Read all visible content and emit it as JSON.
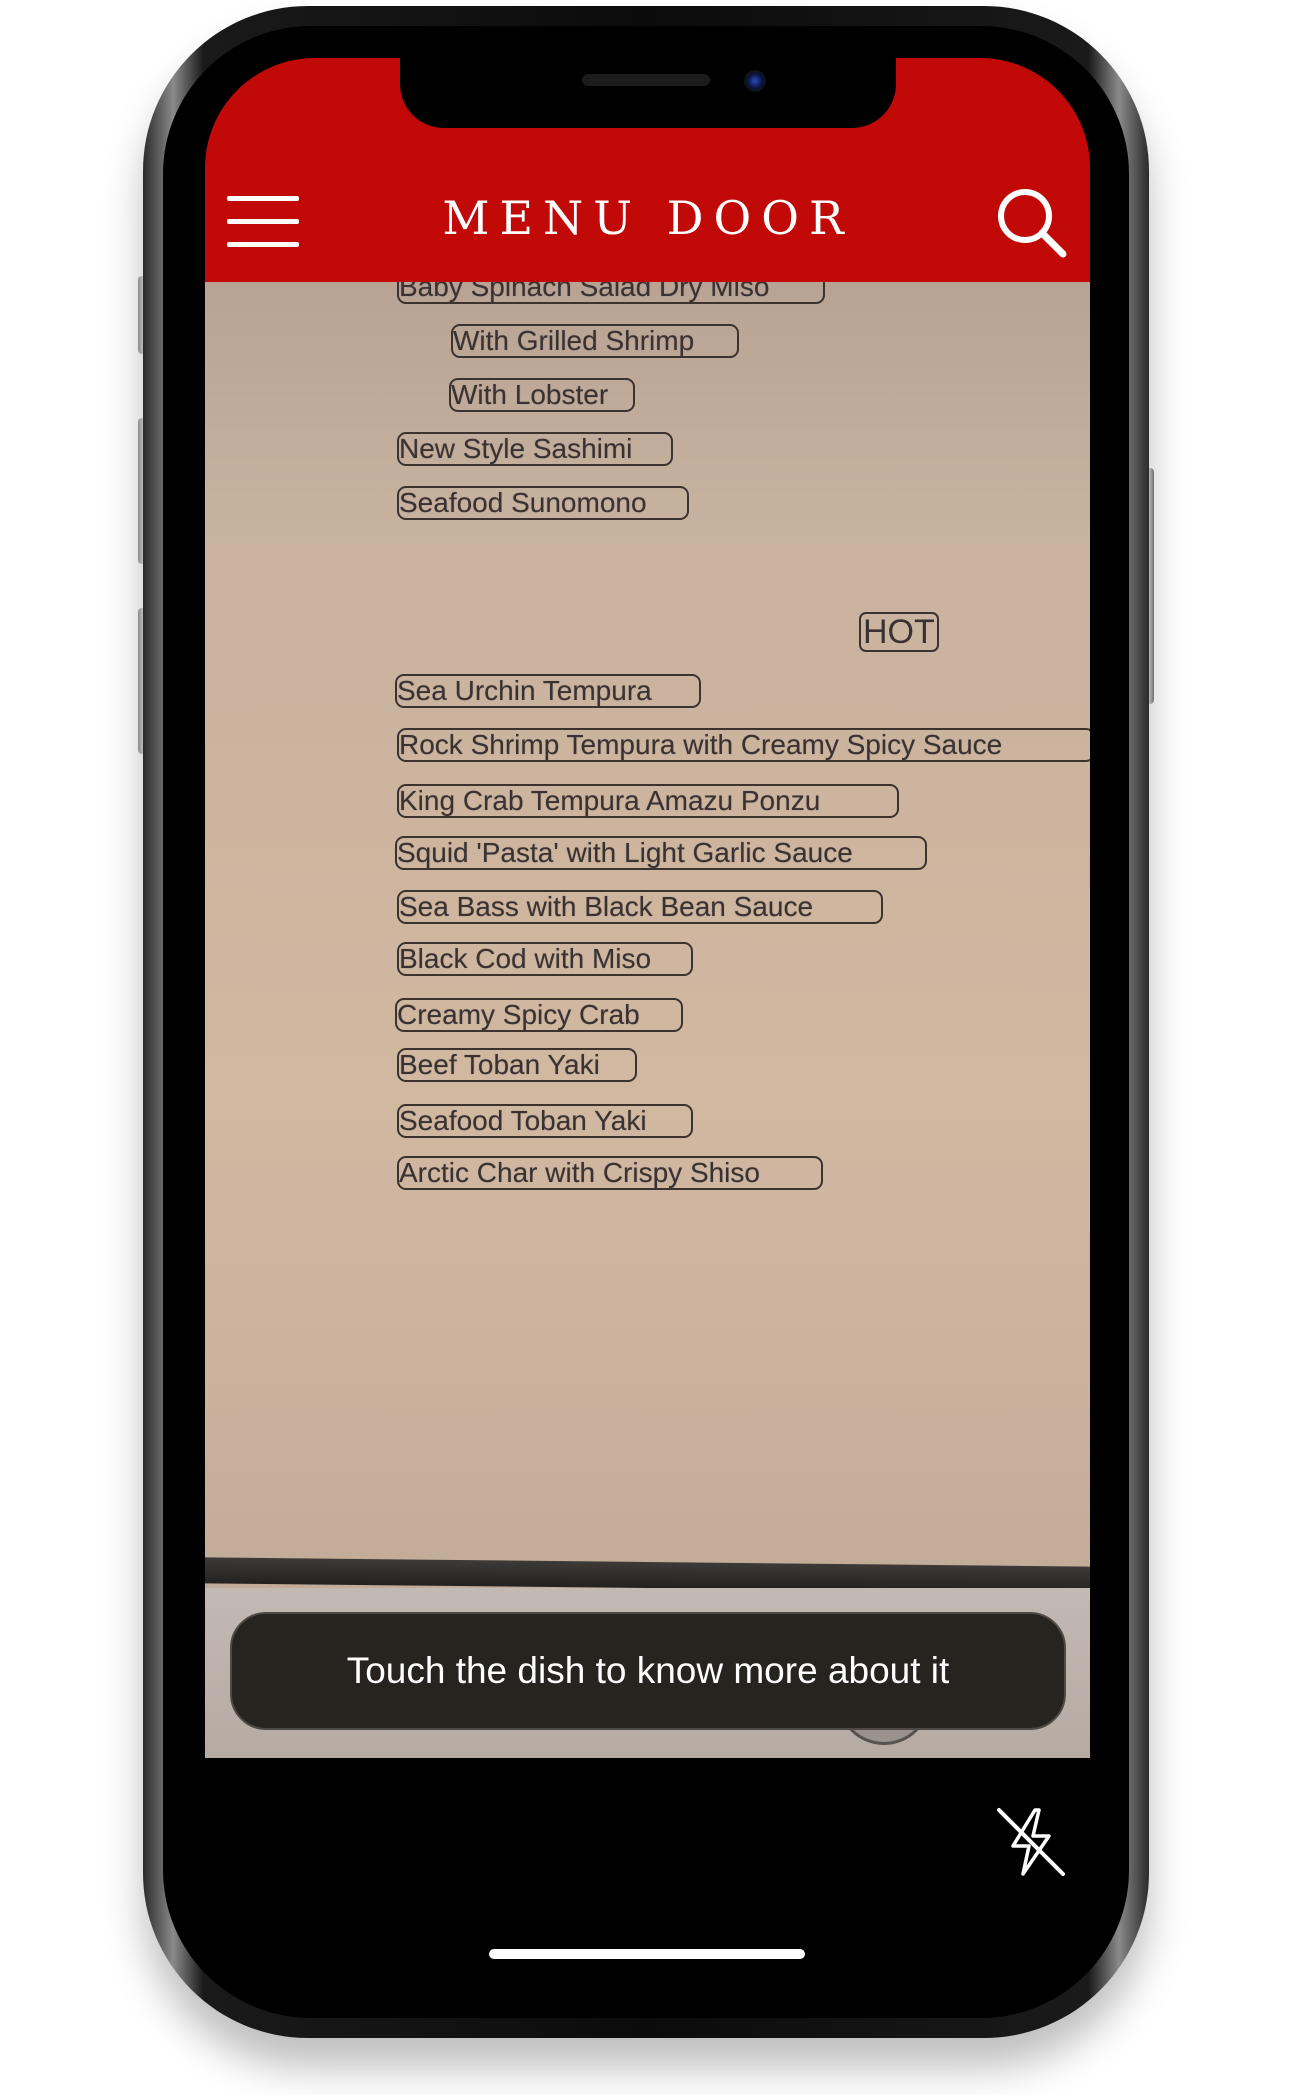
{
  "app": {
    "title": "MENU DOOR",
    "accent_color": "#c10a07"
  },
  "header": {
    "menu_icon": "hamburger-icon",
    "search_icon": "search-icon"
  },
  "menu_scan": {
    "items_top": [
      "Baby Spinach Salad Dry Miso",
      "With Grilled Shrimp",
      "With Lobster",
      "New Style Sashimi",
      "Seafood Sunomono"
    ],
    "section": "HOT",
    "items_hot": [
      "Sea Urchin Tempura",
      "Rock Shrimp Tempura with Creamy Spicy Sauce",
      "King Crab Tempura Amazu Ponzu",
      "Squid 'Pasta' with Light Garlic Sauce",
      "Sea Bass with Black Bean Sauce",
      "Black Cod with Miso",
      "Creamy Spicy Crab",
      "Beef Toban Yaki",
      "Seafood Toban Yaki",
      "Arctic Char with Crispy Shiso"
    ]
  },
  "toast": {
    "message": "Touch the dish to know more about it"
  },
  "bottom_bar": {
    "flash_icon": "flash-off-icon"
  }
}
